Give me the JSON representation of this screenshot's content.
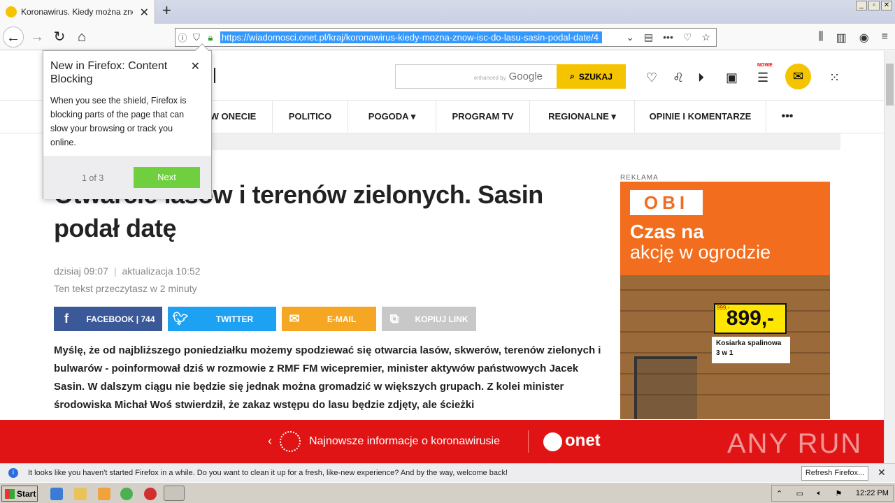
{
  "browser": {
    "tab_title": "Koronawirus. Kiedy można znów iść do lasu",
    "new_tab": "+",
    "url": "https://wiadomosci.onet.pl/kraj/koronawirus-kiedy-mozna-znow-isc-do-lasu-sasin-podal-date/4",
    "window_buttons": [
      "_",
      "▫",
      "✕"
    ]
  },
  "header": {
    "search_brand_prefix": "enhanced by",
    "search_brand": "Google",
    "search_button": "SZUKAJ",
    "nowe_badge": "NOWE"
  },
  "menu": {
    "items": [
      {
        "label": "W ONECIE"
      },
      {
        "label": "POLITICO"
      },
      {
        "label": "POGODA ▾"
      },
      {
        "label": "PROGRAM TV"
      },
      {
        "label": "REGIONALNE ▾"
      },
      {
        "label": "OPINIE I KOMENTARZE"
      },
      {
        "label": "•••"
      }
    ]
  },
  "article": {
    "headline": "Otwarcie lasów i terenów zielonych. Sasin podał datę",
    "published": "dzisiaj 09:07",
    "updated": "aktualizacja 10:52",
    "read_time": "Ten tekst przeczytasz w 2 minuty",
    "share": {
      "facebook": "FACEBOOK | 744",
      "twitter": "TWITTER",
      "email": "E-MAIL",
      "copy": "KOPIUJ LINK"
    },
    "body": "Myślę, że od najbliższego poniedziałku możemy spodziewać się otwarcia lasów, skwerów, terenów zielonych i bulwarów - poinformował dziś w rozmowie z RMF FM wicepremier, minister aktywów państwowych Jacek Sasin. W dalszym ciągu nie będzie się jednak można gromadzić w większych grupach. Z kolei minister środowiska Michał Woś stwierdził, że zakaz wstępu do lasu będzie zdjęty, ale ścieżki"
  },
  "ad": {
    "label": "REKLAMA",
    "logo": "OBI",
    "line1": "Czas na",
    "line2": "akcję w ogrodzie",
    "old_price": "999,-",
    "price": "899,-",
    "product": "Kosiarka spalinowa 3 w 1"
  },
  "popup": {
    "title": "New in Firefox: Content Blocking",
    "text": "When you see the shield, Firefox is blocking parts of the page that can slow your browsing or track you online.",
    "counter": "1 of 3",
    "next": "Next"
  },
  "banner": {
    "text": "Najnowsze informacje o koronawirusie",
    "brand": "onet",
    "watermark": "ANY RUN"
  },
  "notification": {
    "text": "It looks like you haven't started Firefox in a while. Do you want to clean it up for a fresh, like-new experience? And by the way, welcome back!",
    "button": "Refresh Firefox..."
  },
  "taskbar": {
    "start": "Start",
    "clock": "12:22 PM"
  },
  "colors": {
    "accent_yellow": "#f5c400",
    "facebook": "#3b5998",
    "twitter": "#1da1f2",
    "email": "#f5a623",
    "copy": "#c8c8c8",
    "banner_red": "#e01414",
    "obi_orange": "#f26d1d"
  }
}
